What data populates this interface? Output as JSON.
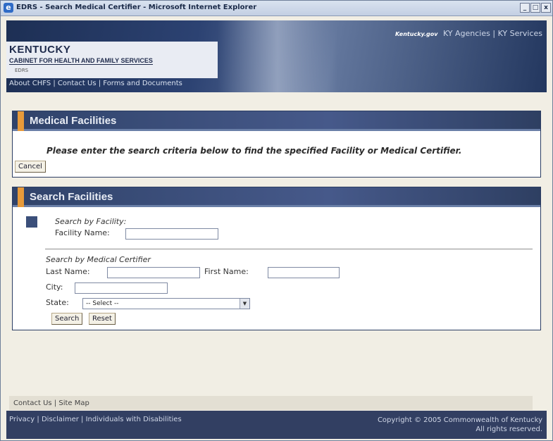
{
  "window": {
    "title": "EDRS - Search Medical Certifier - Microsoft Internet Explorer",
    "controls": [
      "_",
      "□",
      "x"
    ]
  },
  "header": {
    "kentucky_gov": "Kentucky.gov",
    "ky_agencies": "KY Agencies",
    "separator": "|",
    "ky_services": "KY Services",
    "state_name": "KENTUCKY",
    "cabinet_name": "CABINET FOR HEALTH AND FAMILY SERVICES",
    "app_name": "EDRS",
    "nav": {
      "about": "About CHFS",
      "contact": "Contact Us",
      "forms": "Forms and Documents"
    }
  },
  "medical_facilities": {
    "title": "Medical Facilities",
    "instruction": "Please enter the search criteria below to find the specified Facility or Medical Certifier.",
    "cancel_label": "Cancel"
  },
  "search_facilities": {
    "title": "Search Facilities",
    "by_facility_heading": "Search by Facility:",
    "facility_name_label": "Facility Name:",
    "facility_name_value": "",
    "by_certifier_heading": "Search by Medical Certifier",
    "last_name_label": "Last Name:",
    "last_name_value": "",
    "first_name_label": "First Name:",
    "first_name_value": "",
    "city_label": "City:",
    "city_value": "",
    "state_label": "State:",
    "state_selected": "-- Select --",
    "search_label": "Search",
    "reset_label": "Reset"
  },
  "footer": {
    "contact": "Contact Us",
    "site_map": "Site Map",
    "privacy": "Privacy",
    "disclaimer": "Disclaimer",
    "disabilities": "Individuals with Disabilities",
    "copyright": "Copyright © 2005 Commonwealth of Kentucky",
    "rights": "All rights reserved."
  },
  "colors": {
    "header_blue": "#2c4272",
    "panel_header": "#30436a",
    "accent_orange": "#e79a3a",
    "footer_blue": "#323f62"
  }
}
